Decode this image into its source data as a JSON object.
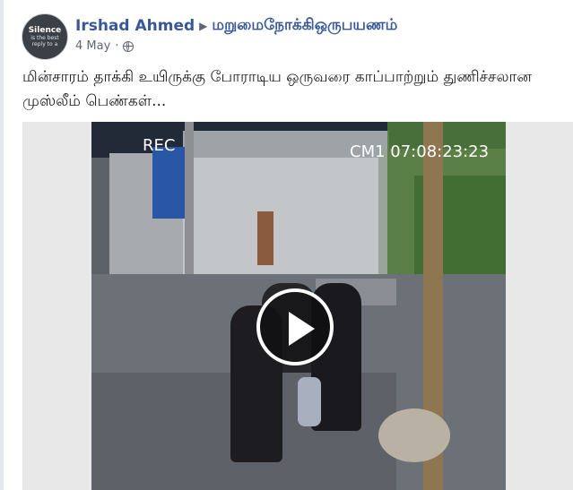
{
  "post": {
    "author": "Irshad Ahmed",
    "group": "மறுமைநோக்கிஒருபயணம்",
    "date": "4 May",
    "privacy_icon": "globe-icon",
    "text": "மின்சாரம் தாக்கி உயிருக்கு போராடிய ஒருவரை காப்பாற்றும் துணிச்சலான முஸ்லீம் பெண்கள்..."
  },
  "avatar": {
    "line1": "Silence",
    "line2": "is the best",
    "line3": "reply to a"
  },
  "video": {
    "overlay_left": "REC",
    "overlay_right": "CM1 07:08:23:23",
    "play_icon": "play-icon"
  }
}
